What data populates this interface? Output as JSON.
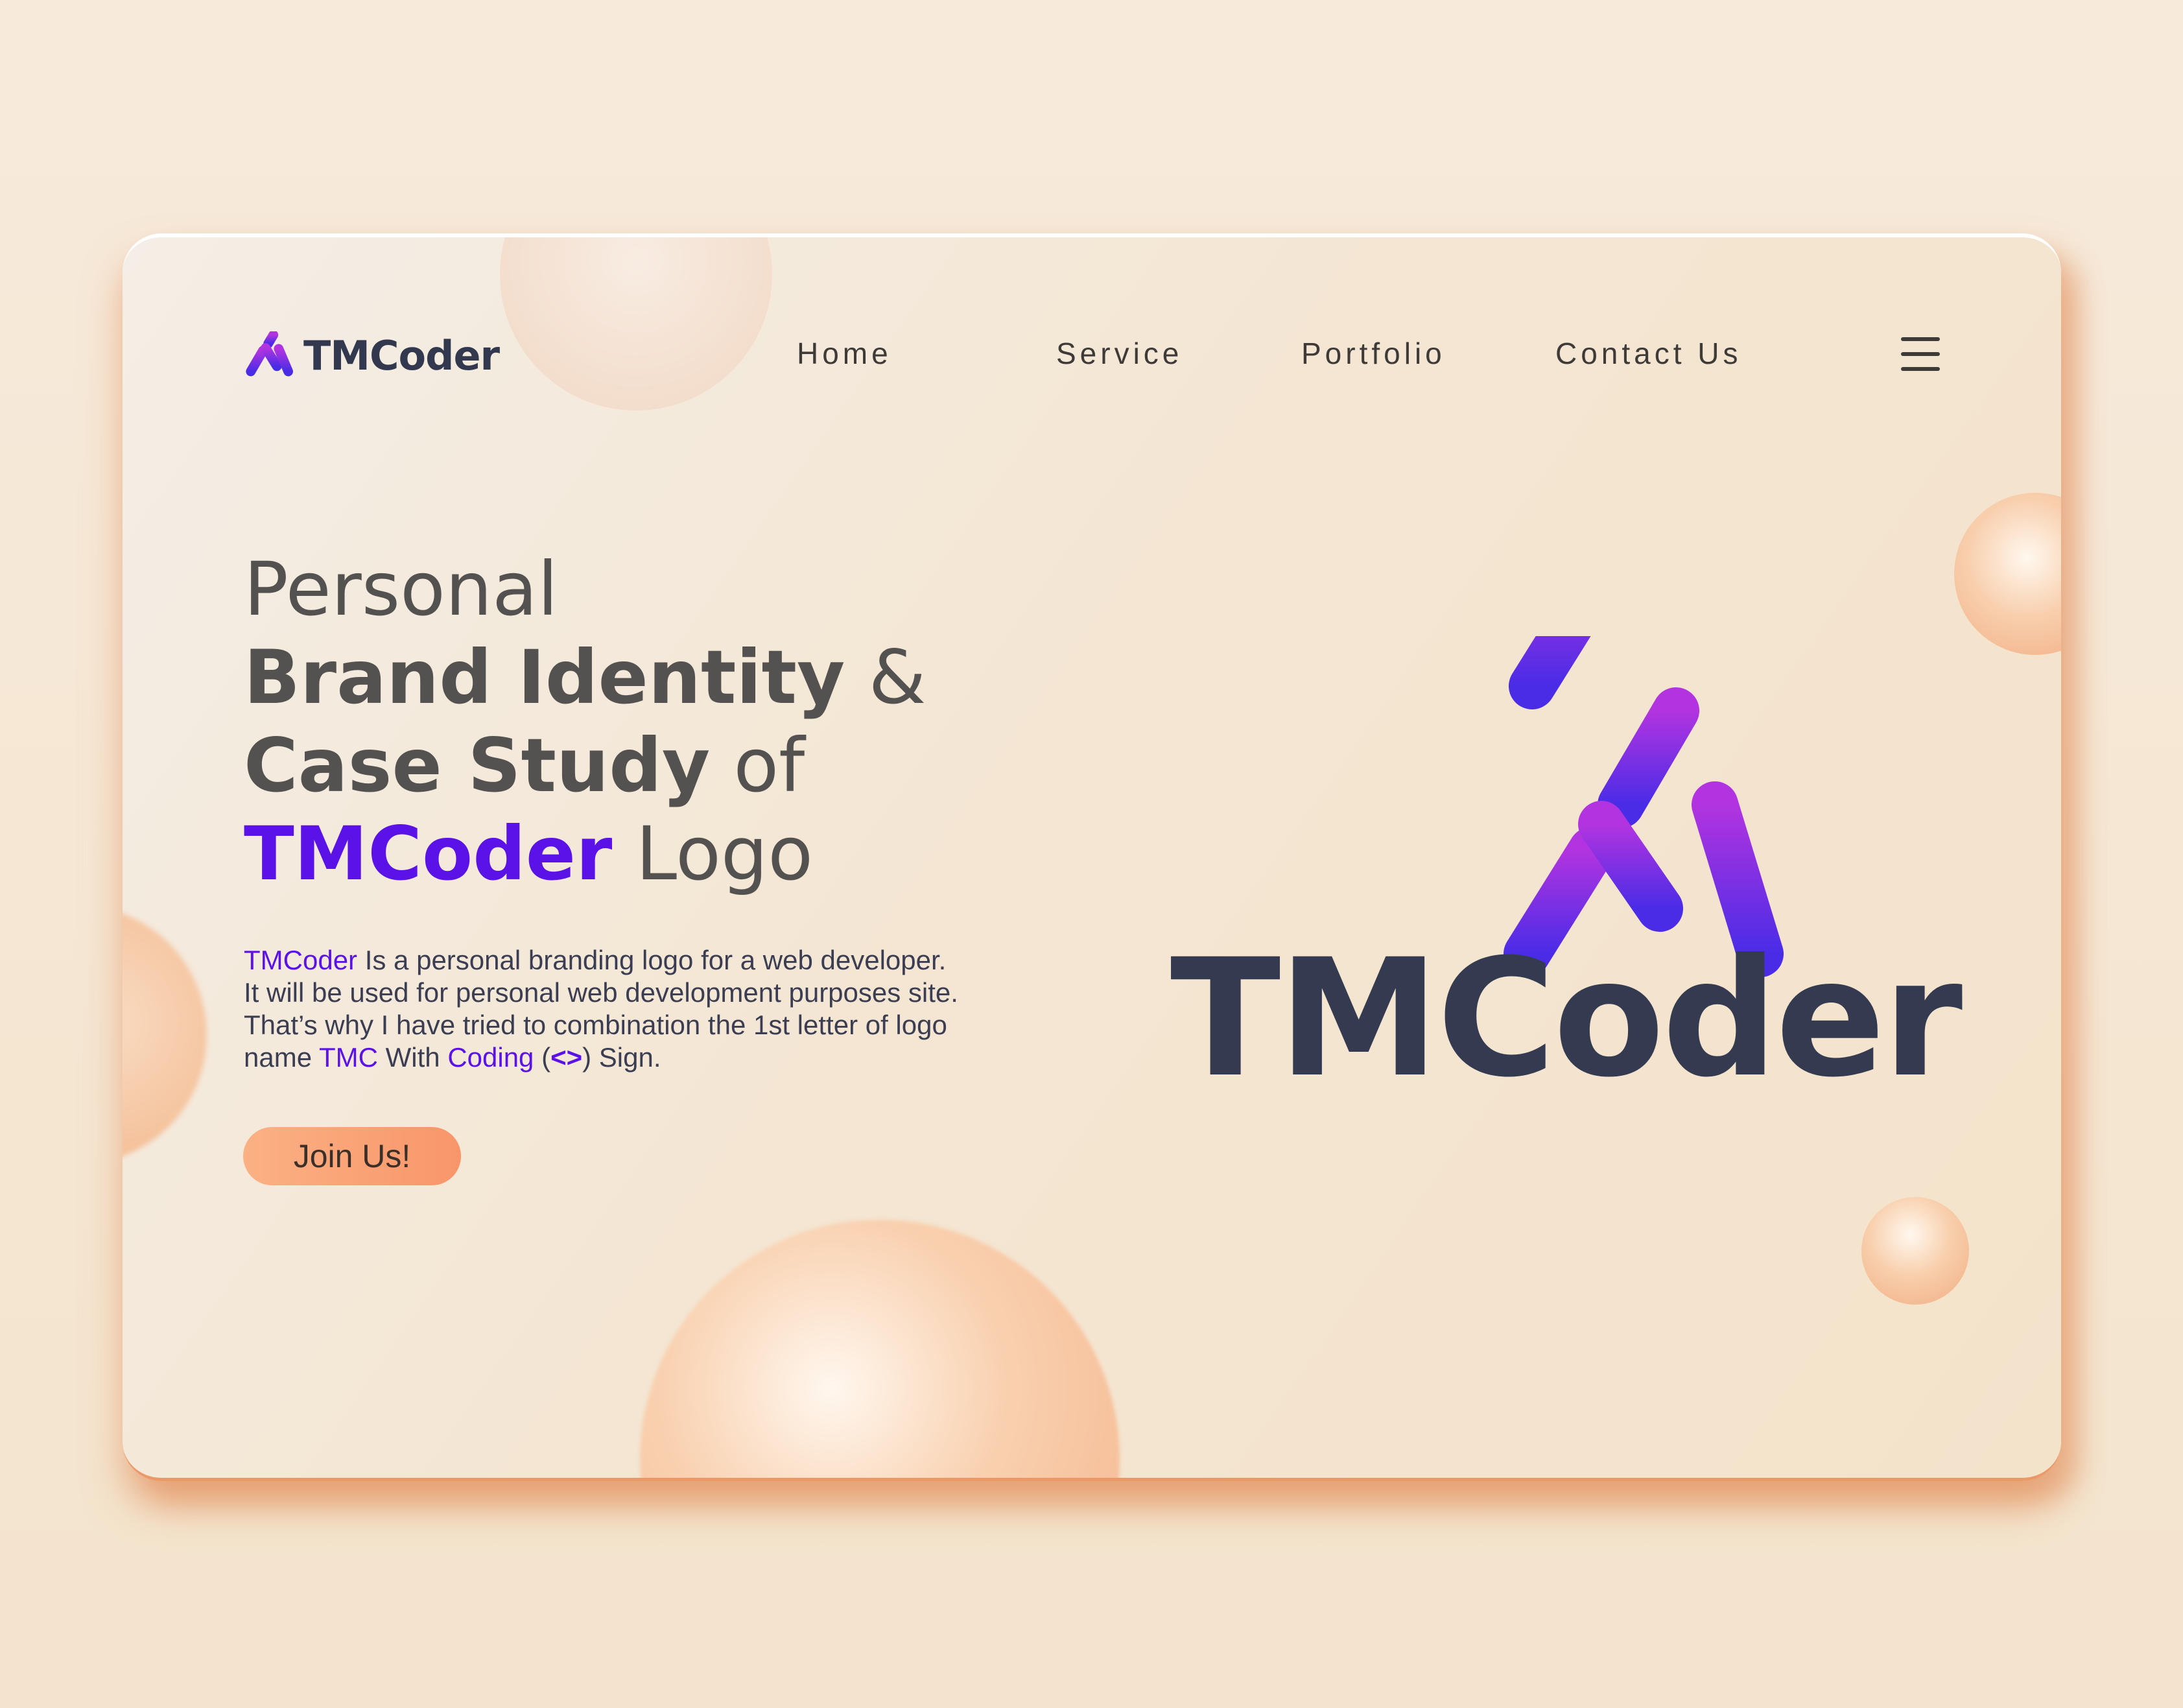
{
  "brand": {
    "name": "TMCoder"
  },
  "nav": {
    "links": [
      "Home",
      "Service",
      "Portfolio",
      "Contact Us"
    ]
  },
  "hero": {
    "line1": "Personal",
    "line2_bold": "Brand Identity",
    "line2_light": " &",
    "line3_bold": "Case Study",
    "line3_light": " of",
    "line4_accent": "TMCoder",
    "line4_light": " Logo",
    "desc": {
      "l1_hl": "TMCoder",
      "l1_rest": " Is a personal branding logo for a web developer.",
      "l2": "It will be used for personal web development purposes site.",
      "l3": "That’s why I have tried to combination the 1st letter of logo",
      "l4_a": "name ",
      "l4_hl1": "TMC",
      "l4_b": " With ",
      "l4_hl2": "Coding",
      "l4_c": " (",
      "l4_hl3": "<>",
      "l4_d": ") Sign."
    },
    "cta_label": "Join Us!"
  },
  "logo": {
    "name": "TMCoder"
  },
  "icons": {
    "brand": "tmcoder-logo-icon",
    "menu": "hamburger-menu-icon"
  },
  "colors": {
    "accent": "#5b12e6",
    "dark": "#343b51",
    "button": "#f8966a",
    "gradient_top": "#b234e0",
    "gradient_bottom": "#4a2ce6"
  }
}
